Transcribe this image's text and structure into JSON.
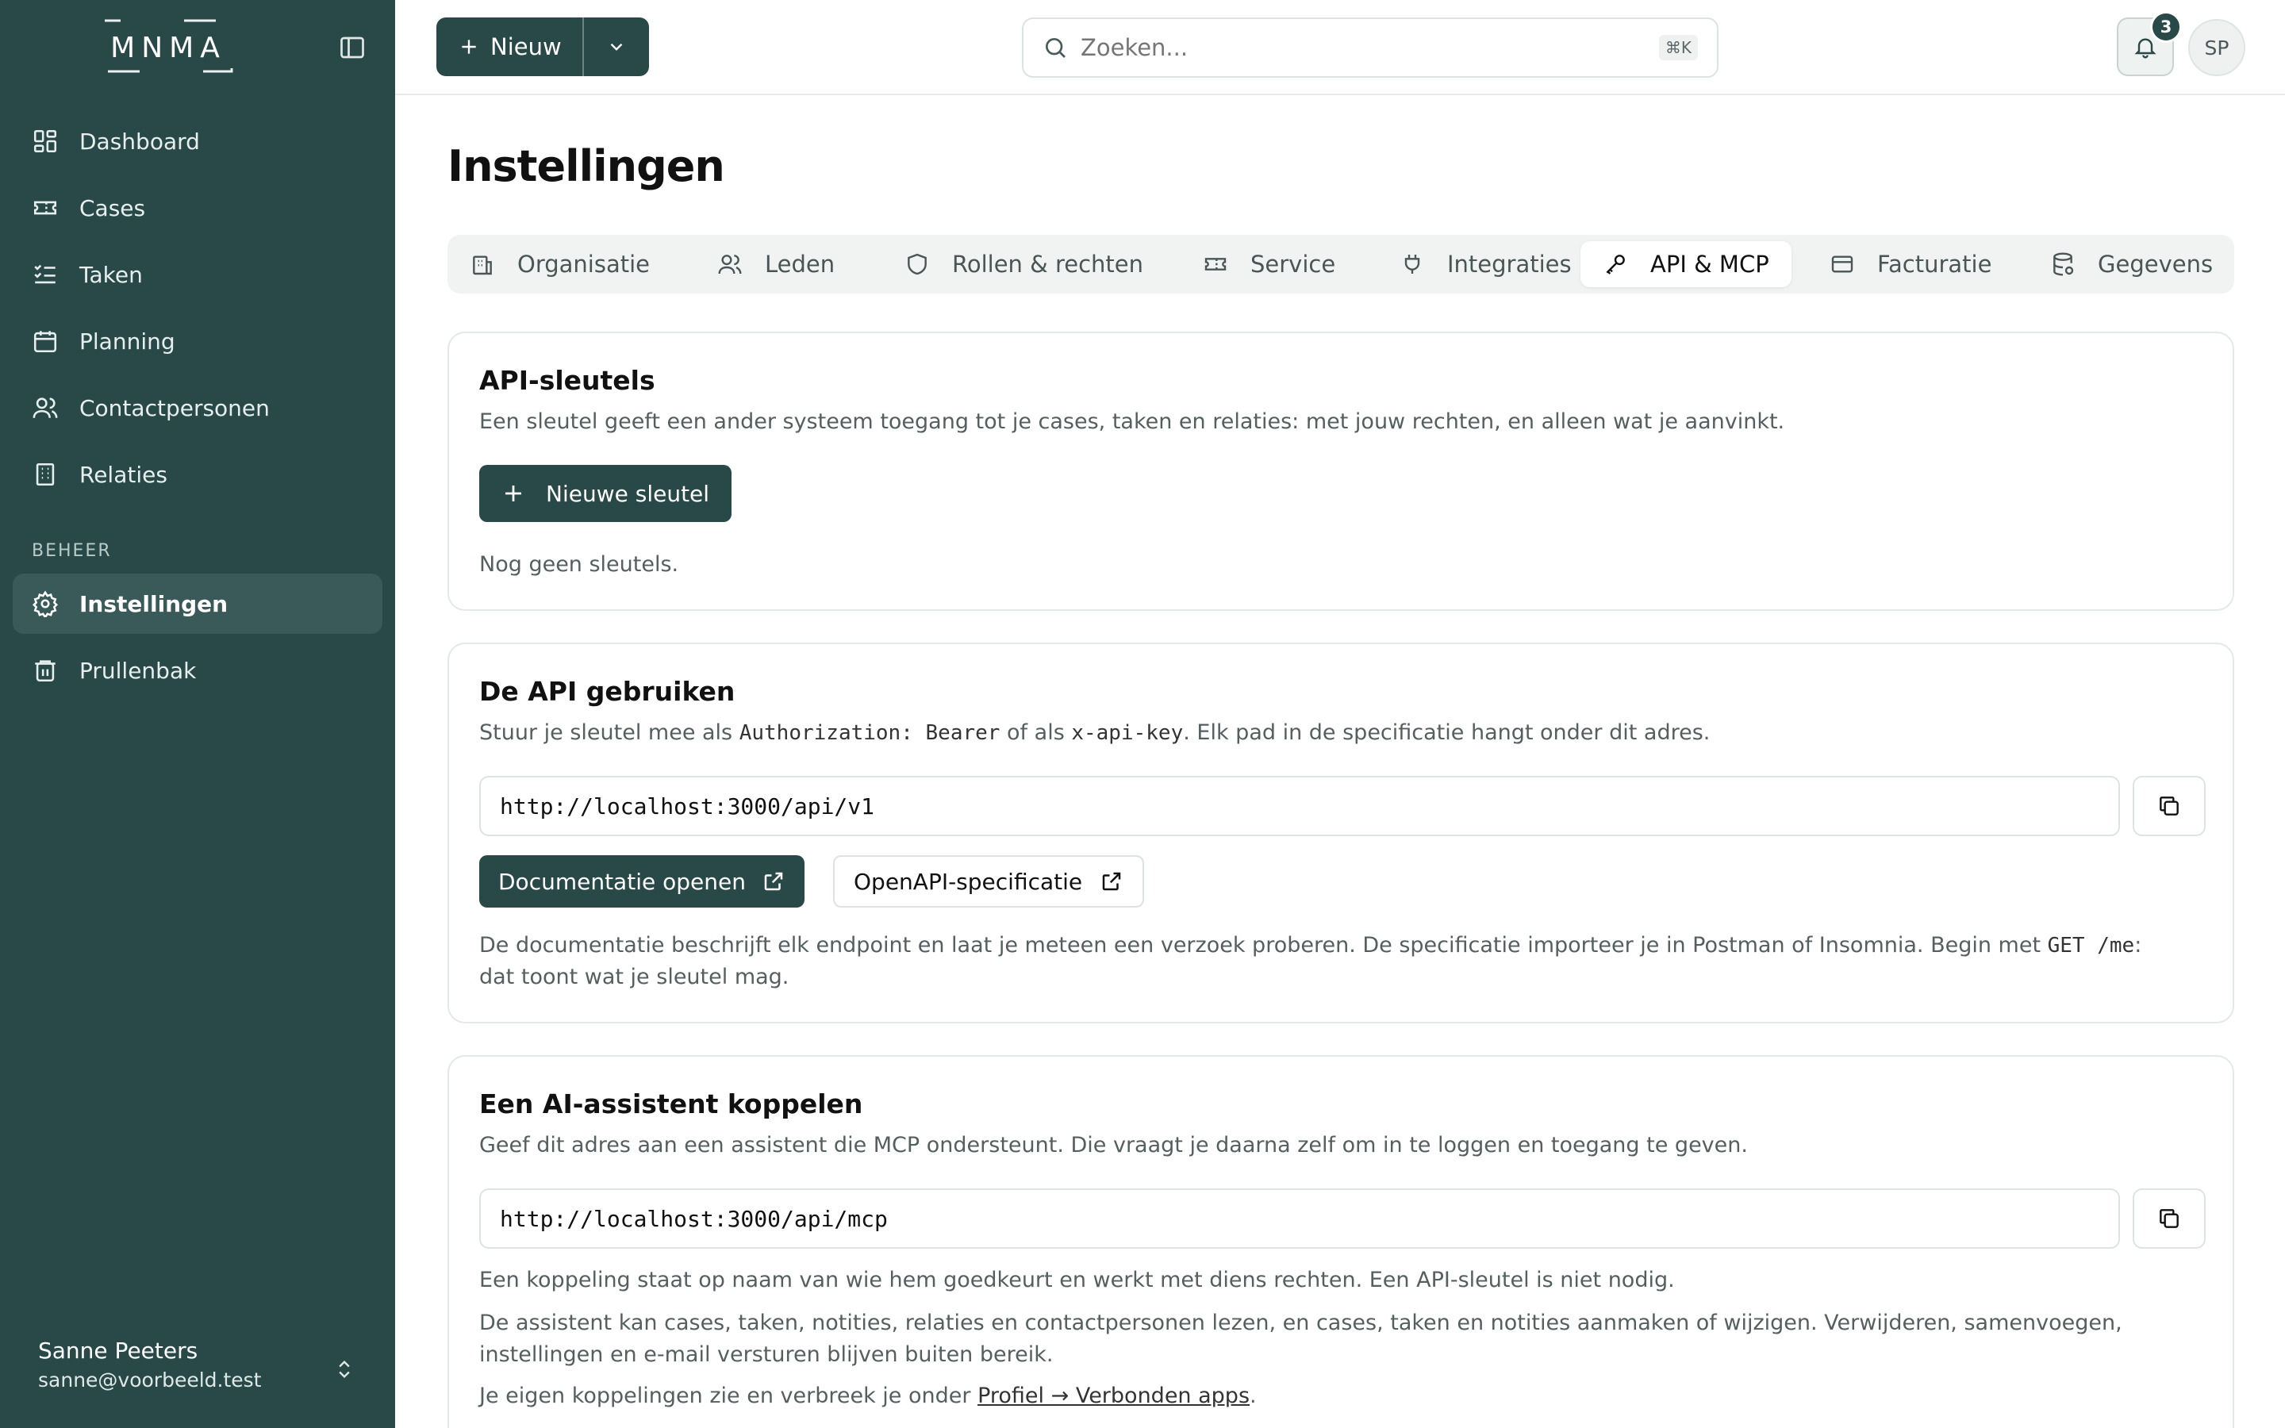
{
  "app": {
    "logo_text": "MNMA",
    "accent": "#294848"
  },
  "sidebar": {
    "items": [
      {
        "label": "Dashboard",
        "icon": "dashboard-icon"
      },
      {
        "label": "Cases",
        "icon": "ticket-icon"
      },
      {
        "label": "Taken",
        "icon": "task-list-icon"
      },
      {
        "label": "Planning",
        "icon": "calendar-icon"
      },
      {
        "label": "Contactpersonen",
        "icon": "users-icon"
      },
      {
        "label": "Relaties",
        "icon": "building-icon"
      }
    ],
    "section_label": "BEHEER",
    "admin_items": [
      {
        "label": "Instellingen",
        "icon": "gear-icon",
        "active": true
      },
      {
        "label": "Prullenbak",
        "icon": "trash-icon"
      }
    ],
    "user": {
      "name": "Sanne Peeters",
      "email": "sanne@voorbeeld.test"
    }
  },
  "topbar": {
    "new_label": "Nieuw",
    "search_placeholder": "Zoeken...",
    "search_shortcut": "⌘K",
    "notification_count": "3",
    "avatar_initials": "SP"
  },
  "page": {
    "title": "Instellingen",
    "tabs": [
      {
        "label": "Organisatie",
        "icon": "building-icon"
      },
      {
        "label": "Leden",
        "icon": "users-icon"
      },
      {
        "label": "Rollen & rechten",
        "icon": "shield-icon"
      },
      {
        "label": "Service",
        "icon": "ticket-icon"
      },
      {
        "label": "Integraties",
        "icon": "plug-icon"
      },
      {
        "label": "API & MCP",
        "icon": "key-icon",
        "active": true
      },
      {
        "label": "Facturatie",
        "icon": "credit-card-icon"
      },
      {
        "label": "Gegevens",
        "icon": "database-icon"
      }
    ]
  },
  "api_keys": {
    "title": "API-sleutels",
    "description": "Een sleutel geeft een ander systeem toegang tot je cases, taken en relaties: met jouw rechten, en alleen wat je aanvinkt.",
    "new_key_label": "Nieuwe sleutel",
    "empty_text": "Nog geen sleutels."
  },
  "api_usage": {
    "title": "De API gebruiken",
    "desc_1": "Stuur je sleutel mee als ",
    "desc_code_1": "Authorization: Bearer",
    "desc_2": " of als ",
    "desc_code_2": "x-api-key",
    "desc_3": ". Elk pad in de specificatie hangt onder dit adres.",
    "url": "http://localhost:3000/api/v1",
    "docs_label": "Documentatie openen",
    "openapi_label": "OpenAPI-specificatie",
    "note_1": "De documentatie beschrijft elk endpoint en laat je meteen een verzoek proberen. De specificatie importeer je in Postman of Insomnia. Begin met ",
    "note_code": "GET /me",
    "note_2": ":",
    "note_3": "dat toont wat je sleutel mag."
  },
  "ai_assistant": {
    "title": "Een AI-assistent koppelen",
    "description": "Geef dit adres aan een assistent die MCP ondersteunt. Die vraagt je daarna zelf om in te loggen en toegang te geven.",
    "url": "http://localhost:3000/api/mcp",
    "para_1": "Een koppeling staat op naam van wie hem goedkeurt en werkt met diens rechten. Een API-sleutel is niet nodig.",
    "para_2a": "De assistent kan cases, taken, notities, relaties en contactpersonen lezen, en cases, taken en notities aanmaken of wijzigen. Verwijderen, samenvoegen,",
    "para_2b": "instellingen en e-mail versturen blijven buiten bereik.",
    "para_3_prefix": "Je eigen koppelingen zie en verbreek je onder ",
    "para_3_link": "Profiel → Verbonden apps",
    "para_3_suffix": "."
  }
}
